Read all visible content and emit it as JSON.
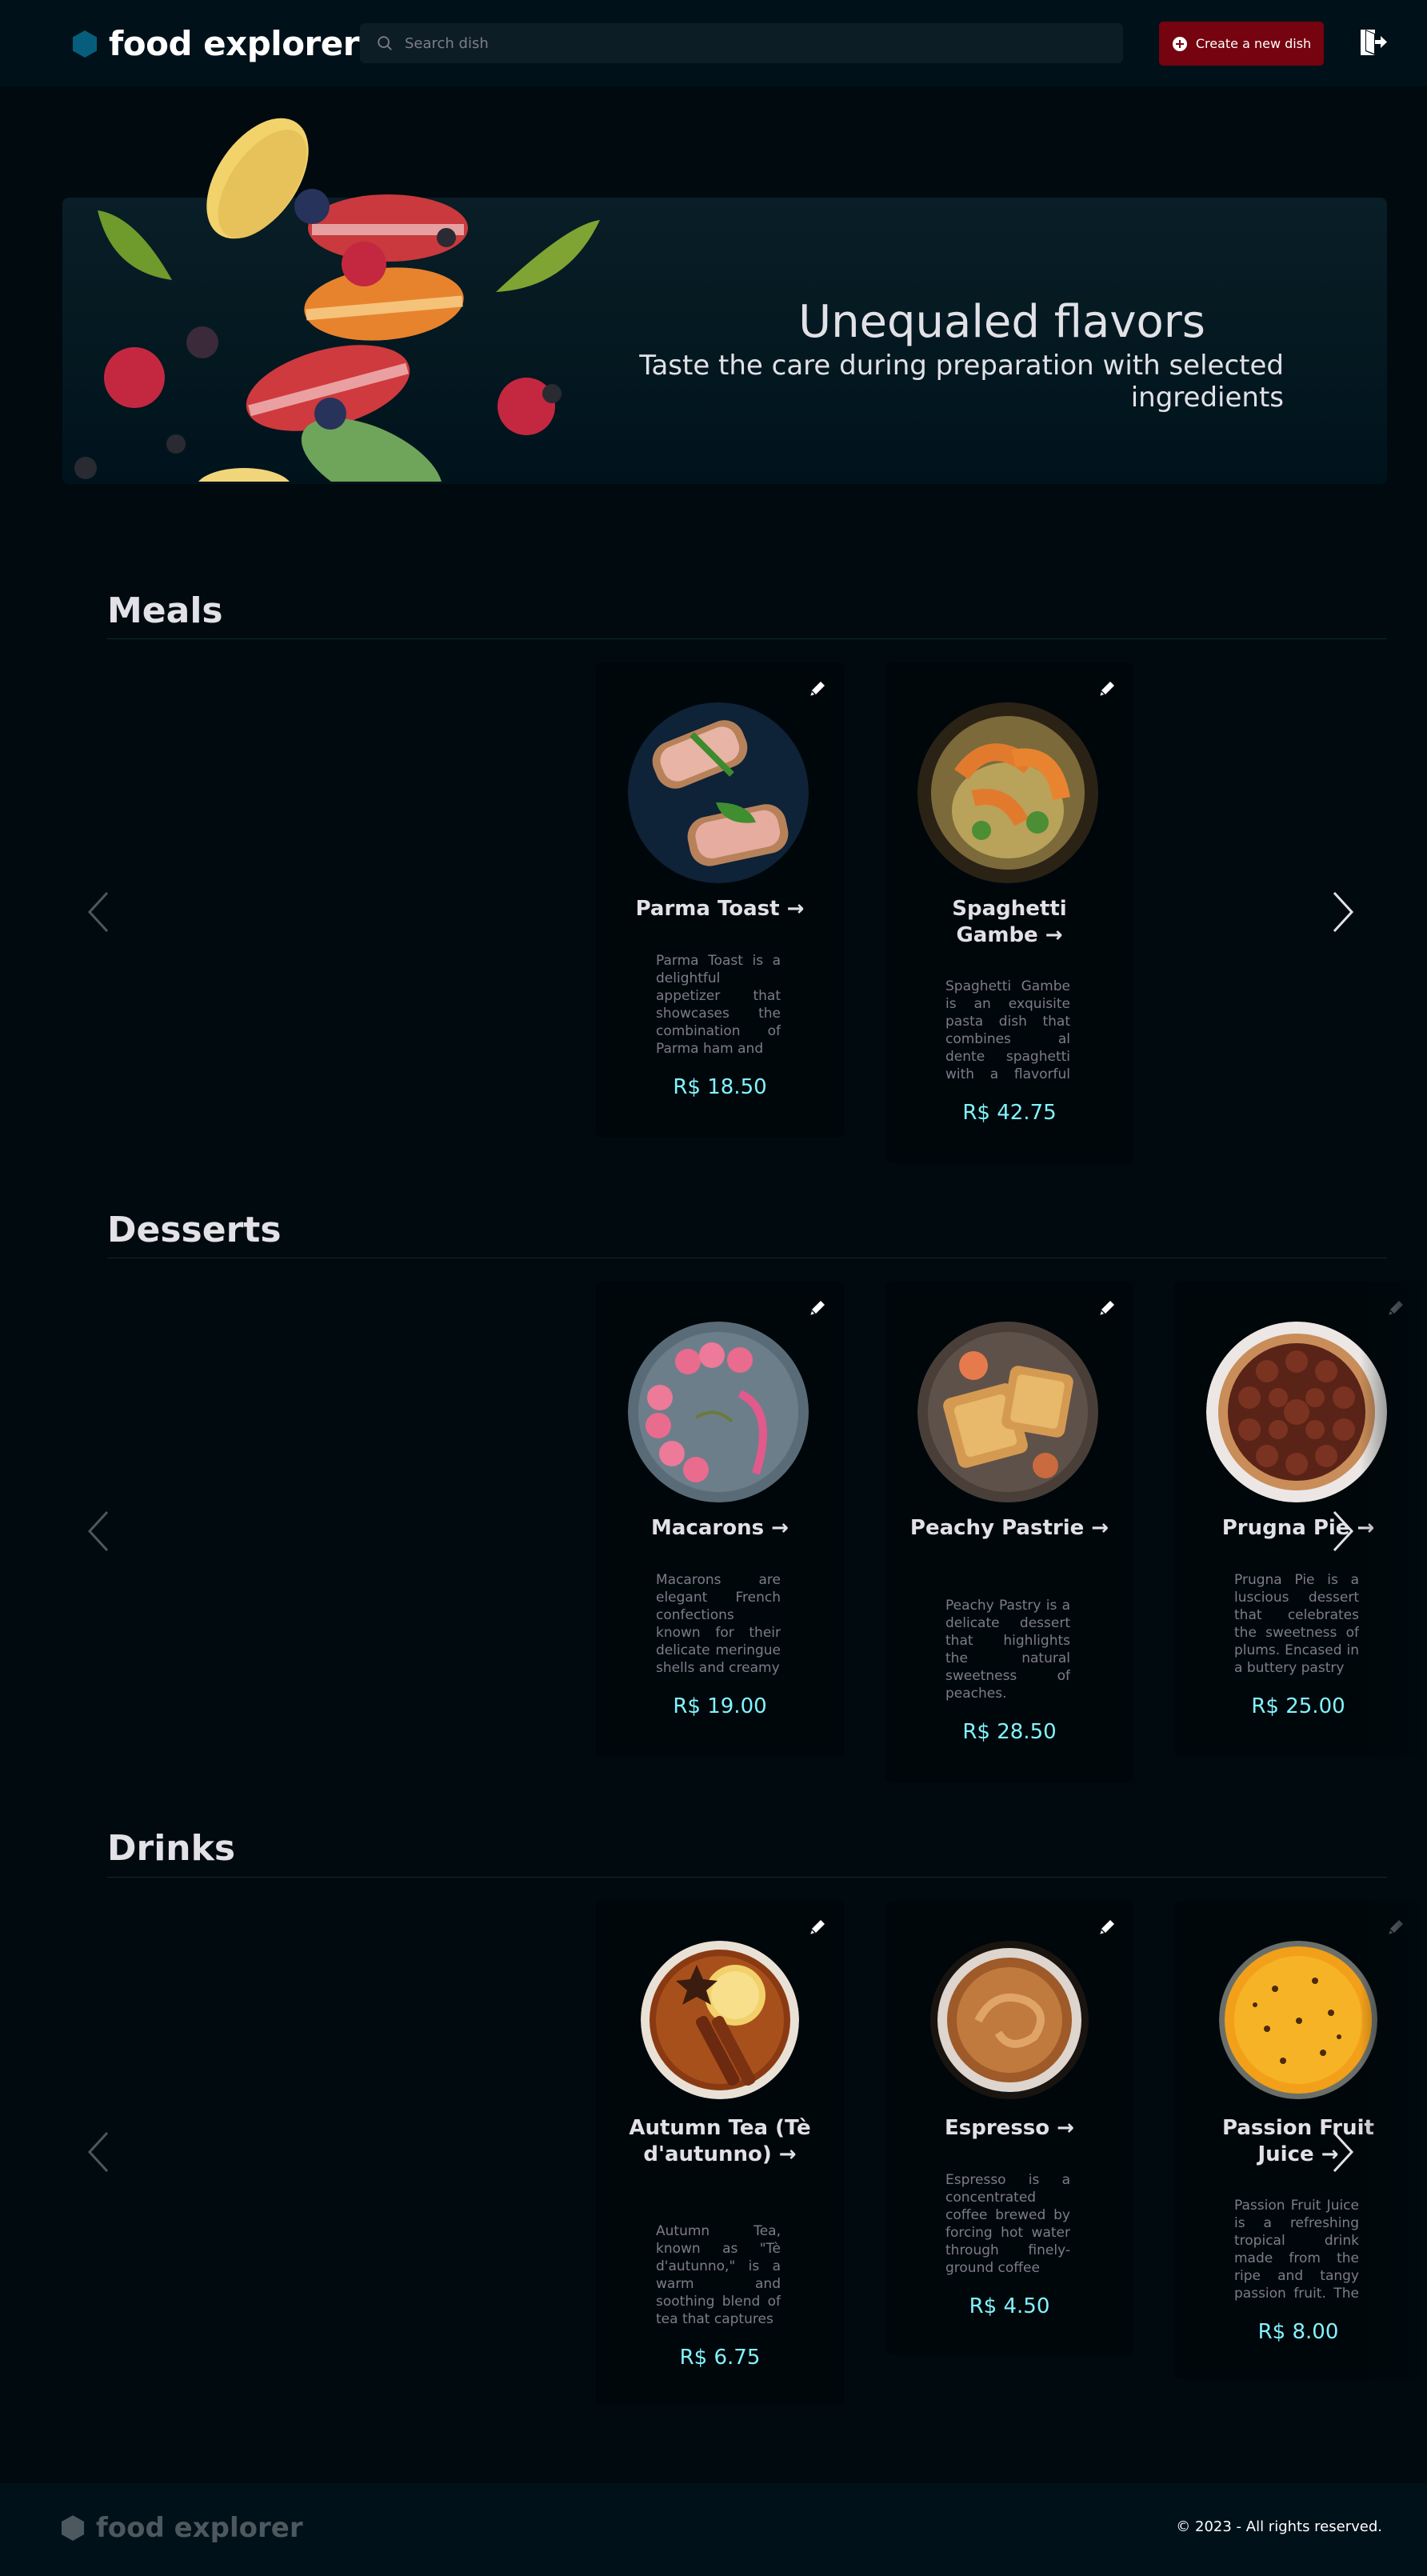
{
  "header": {
    "brand": "food explorer",
    "search_placeholder": "Search dish",
    "create_label": "Create a new dish"
  },
  "banner": {
    "title": "Unequaled flavors",
    "subtitle": "Taste the care during preparation with selected ingredients"
  },
  "sections": [
    {
      "title": "Meals",
      "dishes": [
        {
          "name": "Parma Toast →",
          "desc": "Parma Toast is a delightful appetizer that showcases the combination of Parma ham and",
          "price": "R$ 18.50"
        },
        {
          "name": "Spaghetti Gambe →",
          "desc": "Spaghetti Gambe is an exquisite pasta dish that combines al dente spaghetti with a flavorful sauce",
          "price": "R$ 42.75"
        }
      ]
    },
    {
      "title": "Desserts",
      "dishes": [
        {
          "name": "Macarons →",
          "desc": "Macarons are elegant French confections known for their delicate meringue shells and creamy",
          "price": "R$ 19.00"
        },
        {
          "name": "Peachy Pastrie →",
          "desc": "Peachy Pastry is a delicate dessert that highlights the natural sweetness of peaches. Enclosed in flaky",
          "price": "R$ 28.50"
        },
        {
          "name": "Prugna Pie →",
          "desc": "Prugna Pie is a luscious dessert that celebrates the sweetness of plums. Encased in a buttery pastry",
          "price": "R$ 25.00"
        }
      ]
    },
    {
      "title": "Drinks",
      "dishes": [
        {
          "name": "Autumn Tea (Tè d'autunno) →",
          "desc": "Autumn Tea, known as \"Tè d'autunno,\" is a warm and soothing blend of tea that captures",
          "price": "R$ 6.75"
        },
        {
          "name": "Espresso →",
          "desc": "Espresso is a concentrated coffee brewed by forcing hot water through finely-ground coffee",
          "price": "R$ 4.50"
        },
        {
          "name": "Passion Fruit Juice →",
          "desc": "Passion Fruit Juice is a refreshing tropical drink made from the ripe and tangy passion fruit. The juice is a",
          "price": "R$ 8.00"
        }
      ]
    }
  ],
  "footer": {
    "brand": "food explorer",
    "copyright": "© 2023 - All rights reserved."
  },
  "colors": {
    "background": "#000a0f",
    "header": "#00111a",
    "accent_red": "#750310",
    "price_cyan": "#82f3ff",
    "logo_blue": "#065e7c"
  },
  "icons": [
    "hexagon-logo-icon",
    "search-icon",
    "plus-circle-icon",
    "sign-out-icon",
    "pencil-icon",
    "chevron-left-icon",
    "chevron-right-icon"
  ]
}
